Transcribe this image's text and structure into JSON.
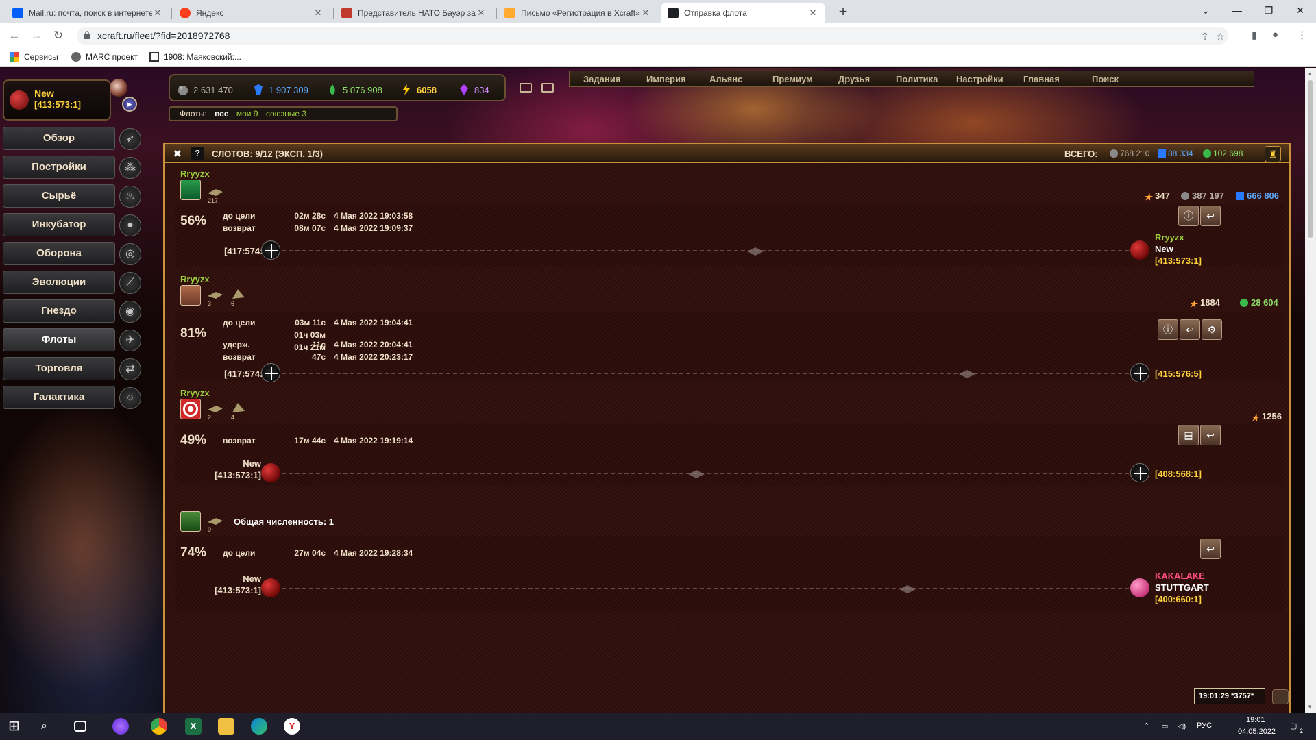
{
  "browser": {
    "tabs": [
      {
        "title": "Mail.ru: почта, поиск в интернете",
        "color": "#005ff9"
      },
      {
        "title": "Яндекс",
        "color": "#fc3f1d"
      },
      {
        "title": "Представитель НАТО Бауэр зая",
        "color": "#c0392b"
      },
      {
        "title": "Письмо «Регистрация в Xcraft»",
        "color": "#ffa930"
      },
      {
        "title": "Отправка флота",
        "color": "#202124"
      }
    ],
    "url": "xcraft.ru/fleet/?fid=2018972768",
    "bookmarks": [
      "Сервисы",
      "MARC проект",
      "1908: Маяковский:..."
    ]
  },
  "resources": {
    "metal": "2 631 470",
    "crystal": "1 907 309",
    "deuterium": "5 076 908",
    "energy": "6058",
    "premium": "834"
  },
  "fleet_filter": {
    "label": "Флоты:",
    "all": "все",
    "mine": "мои 9",
    "allied": "союзные 3"
  },
  "nav": [
    "Задания",
    "Империя",
    "Альянс",
    "Премиум",
    "Друзья",
    "Политика",
    "Настройки",
    "Главная",
    "Поиск"
  ],
  "planet": {
    "name": "New",
    "coords": "[413:573:1]"
  },
  "menu": [
    {
      "label": "Обзор",
      "icon": "rocket-icon"
    },
    {
      "label": "Постройки",
      "icon": "buildings-icon"
    },
    {
      "label": "Сырьё",
      "icon": "resources-icon"
    },
    {
      "label": "Инкубатор",
      "icon": "egg-icon"
    },
    {
      "label": "Оборона",
      "icon": "defense-icon"
    },
    {
      "label": "Эволюции",
      "icon": "evolution-icon"
    },
    {
      "label": "Гнездо",
      "icon": "nest-icon"
    },
    {
      "label": "Флоты",
      "icon": "fleet-icon"
    },
    {
      "label": "Торговля",
      "icon": "trade-icon"
    },
    {
      "label": "Галактика",
      "icon": "galaxy-icon"
    }
  ],
  "panel": {
    "slots": "СЛОТОВ: 9/12 (ЭКСП. 1/3)",
    "total_label": "ВСЕГО:",
    "total_metal": "768 210",
    "total_crystal": "88 334",
    "total_deut": "102 698"
  },
  "fleets": [
    {
      "owner": "Rryyzx",
      "ships": [
        {
          "count": "217"
        }
      ],
      "stars": "347",
      "metal": "387 197",
      "crystal": "666 806",
      "percent": "56%",
      "times": [
        {
          "label": "до цели",
          "dur": "02м 28с",
          "at": "4 Мая 2022 19:03:58"
        },
        {
          "label": "возврат",
          "dur": "08м 07с",
          "at": "4 Мая 2022 19:09:37"
        }
      ],
      "from": "[417:574:6]",
      "to_owner": "Rryyzx",
      "to_name": "New",
      "to_coords": "[413:573:1]",
      "progress": 0.56
    },
    {
      "owner": "Rryyzx",
      "ships": [
        {
          "count": "3"
        },
        {
          "count": "6"
        }
      ],
      "stars": "1884",
      "deut": "28 604",
      "percent": "81%",
      "times": [
        {
          "label": "до цели",
          "dur": "03м 11с",
          "at": "4 Мая 2022 19:04:41"
        },
        {
          "label": "удерж.",
          "dur": "01ч 03м 11с",
          "at": "4 Мая 2022 20:04:41"
        },
        {
          "label": "возврат",
          "dur": "01ч 21м 47с",
          "at": "4 Мая 2022 20:23:17"
        }
      ],
      "from": "[417:574:6]",
      "to_coords": "[415:576:5]",
      "progress": 0.81
    },
    {
      "owner": "Rryyzx",
      "ships": [
        {
          "count": "2"
        },
        {
          "count": "4"
        }
      ],
      "stars": "1256",
      "percent": "49%",
      "times": [
        {
          "label": "возврат",
          "dur": "17м 44с",
          "at": "4 Мая 2022 19:19:14"
        }
      ],
      "from_name": "New",
      "from_coords": "[413:573:1]",
      "to_coords": "[408:568:1]",
      "progress": 0.49
    },
    {
      "ships": [
        {
          "count": "0"
        }
      ],
      "total_label": "Общая численность: 1",
      "percent": "74%",
      "times": [
        {
          "label": "до цели",
          "dur": "27м 04с",
          "at": "4 Мая 2022 19:28:34"
        }
      ],
      "from_name": "New",
      "from_coords": "[413:573:1]",
      "to_owner": "KAKALAKE",
      "to_name": "STUTTGART",
      "to_coords": "[400:660:1]",
      "progress": 0.74
    }
  ],
  "clock": "19:01:29 *3757*",
  "taskbar": {
    "lang": "РУС",
    "time": "19:01",
    "date": "04.05.2022",
    "notif": "2"
  },
  "colors": {
    "accent": "#c8913a",
    "owner": "#9ccf3c",
    "enemy": "#ff4f7a",
    "planet": "#ffd23c"
  }
}
